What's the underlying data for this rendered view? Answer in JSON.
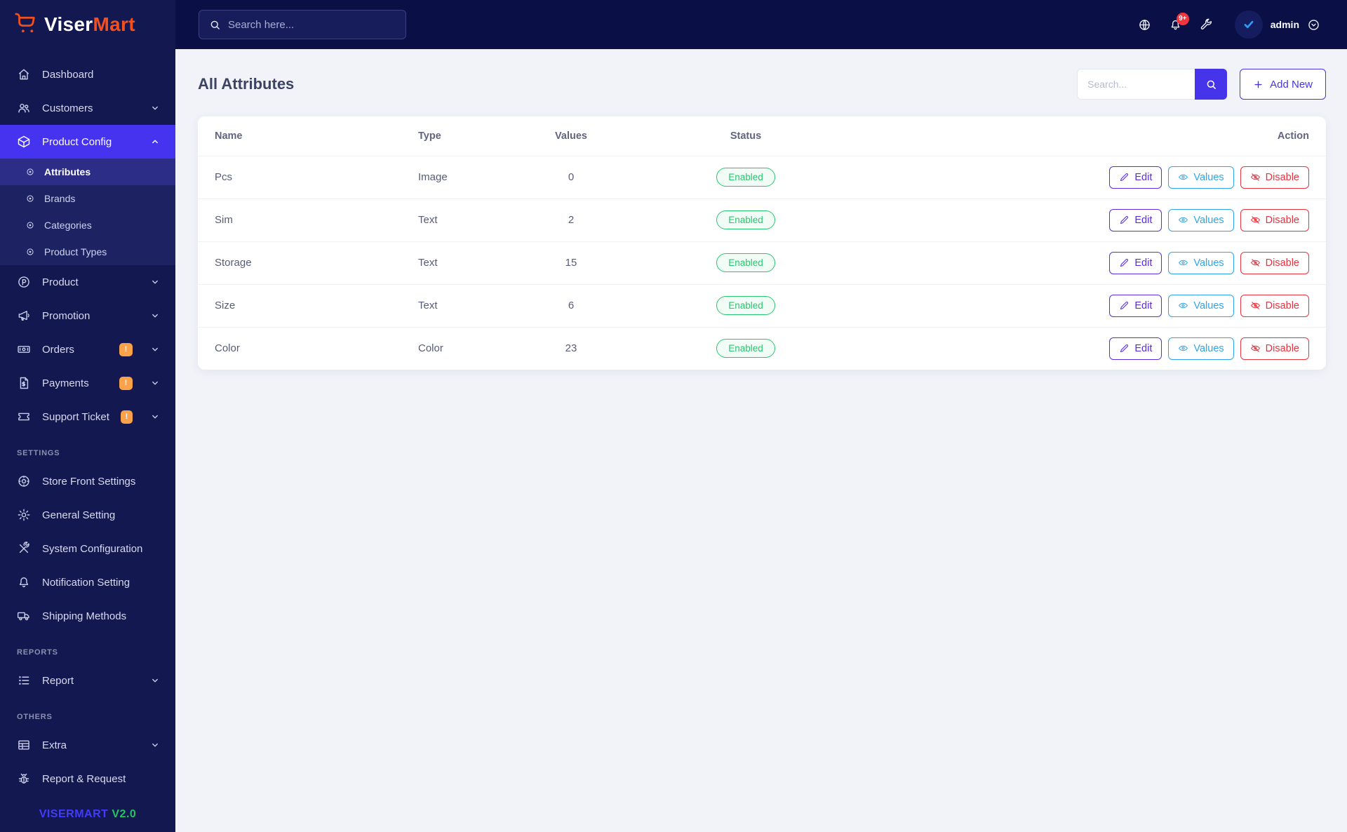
{
  "colors": {
    "primary": "#4634eb",
    "sidebar_active": "#4533f0",
    "info": "#2ea5ea",
    "danger": "#e8323e",
    "success": "#28c76f",
    "warning_badge": "#faa14b",
    "brand_orange": "#f4501e",
    "version_green": "#21c55d",
    "sidebar_bg": "#131850",
    "topbar_bg": "#0a1046"
  },
  "brand": {
    "logo_text_1": "Viser",
    "logo_text_2": "Mart"
  },
  "header": {
    "search_placeholder": "Search here...",
    "notification_badge": "9+",
    "username": "admin"
  },
  "sidebar": {
    "badge_text": "!",
    "menu": [
      {
        "label": "Dashboard"
      },
      {
        "label": "Customers"
      },
      {
        "label": "Product Config"
      },
      {
        "label": "Product"
      },
      {
        "label": "Promotion"
      },
      {
        "label": "Orders"
      },
      {
        "label": "Payments"
      },
      {
        "label": "Support Ticket"
      },
      {
        "label": "Store Front Settings"
      },
      {
        "label": "General Setting"
      },
      {
        "label": "System Configuration"
      },
      {
        "label": "Notification Setting"
      },
      {
        "label": "Shipping Methods"
      },
      {
        "label": "Report"
      },
      {
        "label": "Extra"
      },
      {
        "label": "Report & Request"
      }
    ],
    "submenu": [
      {
        "label": "Attributes"
      },
      {
        "label": "Brands"
      },
      {
        "label": "Categories"
      },
      {
        "label": "Product Types"
      }
    ],
    "sections": {
      "settings": "SETTINGS",
      "reports": "REPORTS",
      "others": "OTHERS"
    },
    "version": {
      "name": "VISERMART",
      "number": "V2.0"
    }
  },
  "page": {
    "title": "All Attributes",
    "search_placeholder": "Search...",
    "add_new_label": "Add New"
  },
  "table": {
    "columns": [
      "Name",
      "Type",
      "Values",
      "Status",
      "Action"
    ],
    "rows": [
      {
        "name": "Pcs",
        "type": "Image",
        "values": "0",
        "status": "Enabled"
      },
      {
        "name": "Sim",
        "type": "Text",
        "values": "2",
        "status": "Enabled"
      },
      {
        "name": "Storage",
        "type": "Text",
        "values": "15",
        "status": "Enabled"
      },
      {
        "name": "Size",
        "type": "Text",
        "values": "6",
        "status": "Enabled"
      },
      {
        "name": "Color",
        "type": "Color",
        "values": "23",
        "status": "Enabled"
      }
    ],
    "actions": {
      "edit": "Edit",
      "values": "Values",
      "disable": "Disable"
    }
  }
}
